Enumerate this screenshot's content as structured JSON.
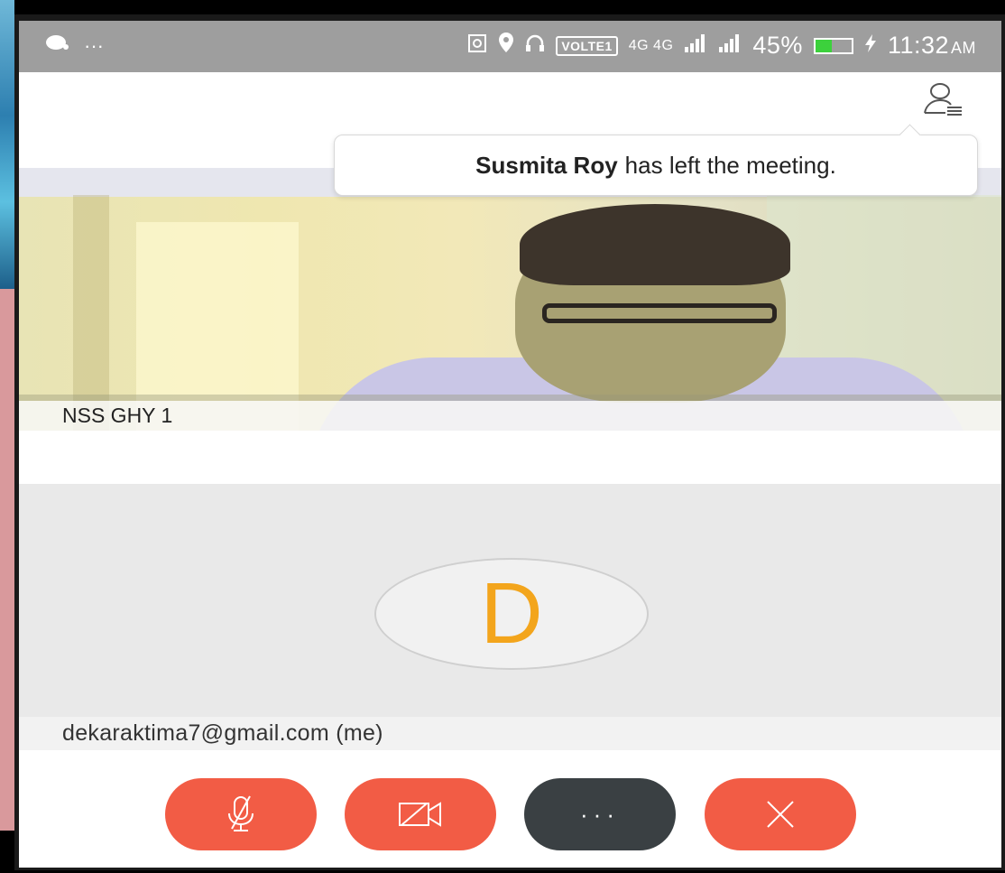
{
  "status_bar": {
    "left_icons": [
      "chat-bubble-icon",
      "more-dots-icon"
    ],
    "left_dots": "···",
    "volte": "VOLTE1",
    "network": "4G 4G",
    "battery": "45%",
    "battery_level": 0.45,
    "battery_color": "#3cd13c",
    "time": "11:32",
    "ampm": "AM"
  },
  "notification": {
    "name": "Susmita Roy",
    "message": "has left the meeting."
  },
  "remote_participant": {
    "name": "NSS GHY 1"
  },
  "self_participant": {
    "initial": "D",
    "initial_color": "#f3a51c",
    "label": "dekaraktima7@gmail.com (me)"
  },
  "controls": {
    "mic": {
      "icon": "microphone-muted-icon",
      "color": "#f25c45"
    },
    "video": {
      "icon": "video-off-icon",
      "color": "#f25c45"
    },
    "more": {
      "icon": "more-horizontal-icon",
      "label": "···",
      "color": "#3a4043"
    },
    "leave": {
      "icon": "close-icon",
      "color": "#f25c45"
    }
  }
}
